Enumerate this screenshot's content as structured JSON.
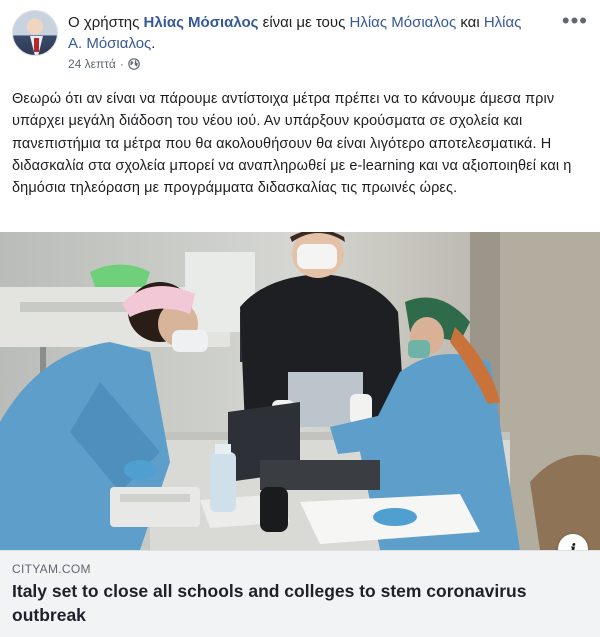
{
  "post": {
    "author_prefix": "Ο χρήστης ",
    "author_name": "Ηλίας Μόσιαλος",
    "with_text": " είναι με τους ",
    "tagged_1": "Ηλίας Μόσιαλος",
    "and_text": " και ",
    "tagged_2": "Ηλίας Α. Μόσιαλος",
    "end_text": ".",
    "timestamp": "24 λεπτά",
    "separator": "·",
    "audience_icon": "globe-icon",
    "more_icon": "more-options-icon",
    "body": "Θεωρώ ότι αν είναι να πάρουμε αντίστοιχα μέτρα πρέπει να το κάνουμε άμεσα πριν υπάρχει μεγάλη διάδοση του νέου ιού. Αν υπάρξουν κρούσματα σε σχολεία και πανεπιστήμια τα μέτρα που θα ακολουθήσουν θα είναι λιγότερο αποτελεσματικά. Η διδασκαλία στα σχολεία μπορεί να αναπληρωθεί με e-learning και να αξιοποιηθεί και η δημόσια τηλεόραση με προγράμματα διδασκαλίας τις πρωινές ώρες."
  },
  "link": {
    "info_icon": "info-icon",
    "info_glyph": "i",
    "domain": "CITYAM.COM",
    "headline": "Italy set to close all schools and colleges to stem coronavirus outbreak"
  },
  "colors": {
    "link_blue": "#365899",
    "meta_gray": "#606770",
    "preview_bg": "#f2f3f5",
    "scrubs_blue": "#5e9ecb"
  }
}
